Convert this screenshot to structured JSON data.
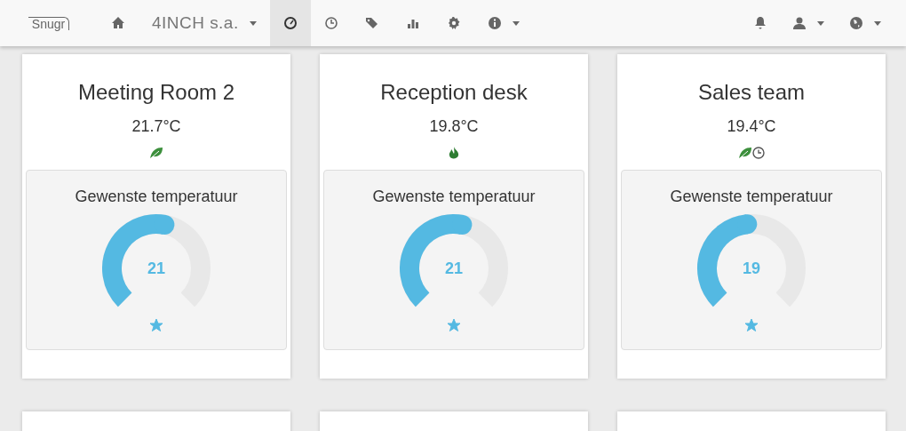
{
  "navbar": {
    "brand": "Snugr",
    "company": "4INCH s.a.",
    "items": [
      {
        "kind": "home",
        "selected": false,
        "caret": false
      },
      {
        "kind": "company",
        "selected": false,
        "caret": true
      },
      {
        "kind": "gauge",
        "selected": true,
        "caret": false
      },
      {
        "kind": "clock",
        "selected": false,
        "caret": false
      },
      {
        "kind": "tags",
        "selected": false,
        "caret": false
      },
      {
        "kind": "chart",
        "selected": false,
        "caret": false
      },
      {
        "kind": "gear",
        "selected": false,
        "caret": false
      },
      {
        "kind": "info",
        "selected": false,
        "caret": true
      }
    ],
    "right_items": [
      {
        "kind": "bell",
        "caret": false
      },
      {
        "kind": "user",
        "caret": true
      },
      {
        "kind": "globe",
        "caret": true
      }
    ]
  },
  "rooms": [
    {
      "kind": "full",
      "name": "Meeting Room 2",
      "temperature": "21.7°C",
      "status_icons": [
        {
          "kind": "leaf"
        }
      ],
      "setpoint_label": "Gewenste temperatuur",
      "setpoint": "21",
      "level": 0.54,
      "favorite": true
    },
    {
      "kind": "full",
      "name": "Reception desk",
      "temperature": "19.8°C",
      "status_icons": [
        {
          "kind": "flame"
        }
      ],
      "setpoint_label": "Gewenste temperatuur",
      "setpoint": "21",
      "level": 0.54,
      "favorite": true
    },
    {
      "kind": "full",
      "name": "Sales team",
      "temperature": "19.4°C",
      "status_icons": [
        {
          "kind": "leaf"
        },
        {
          "kind": "clock"
        }
      ],
      "setpoint_label": "Gewenste temperatuur",
      "setpoint": "19",
      "level": 0.48,
      "favorite": true
    },
    {
      "kind": "cut"
    },
    {
      "kind": "cut"
    },
    {
      "kind": "cut"
    }
  ]
}
